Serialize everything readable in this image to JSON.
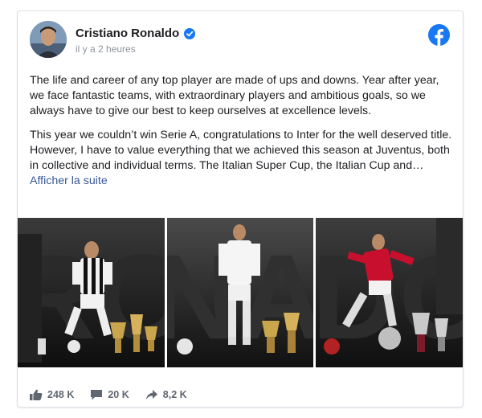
{
  "post": {
    "author": "Cristiano Ronaldo",
    "timestamp": "il y a 2 heures",
    "verified_icon": "verified-badge-icon",
    "platform_icon": "facebook-logo-icon",
    "paragraph_1": "The life and career of any top player are made of ups and downs. Year after year, we face fantastic teams, with extraordinary players and ambitious goals, so we always have to give our best to keep ourselves at excellence levels.",
    "paragraph_2": "This year we couldn’t win Serie A, congratulations to Inter for the well deserved title. However, I have to value everything that we achieved this season at Juventus, both in collective and individual terms. The Italian Super Cup, the Italian Cup and…",
    "see_more": "Afficher la suite"
  },
  "gallery": {
    "panels": [
      {
        "name": "juventus-panel",
        "kit_color": "#f2f2f2",
        "stripe_color": "#111111"
      },
      {
        "name": "real-madrid-panel",
        "kit_color": "#f5f5f5",
        "stripe_color": "#e6e6e6"
      },
      {
        "name": "manchester-united-panel",
        "kit_color": "#c8102e",
        "stripe_color": "#a50d24"
      }
    ],
    "background_text": "RONALDO"
  },
  "footer": {
    "likes": "248 K",
    "comments": "20 K",
    "shares": "8,2 K"
  },
  "colors": {
    "facebook_blue": "#1877f2",
    "link": "#385898",
    "muted": "#8d949e"
  }
}
